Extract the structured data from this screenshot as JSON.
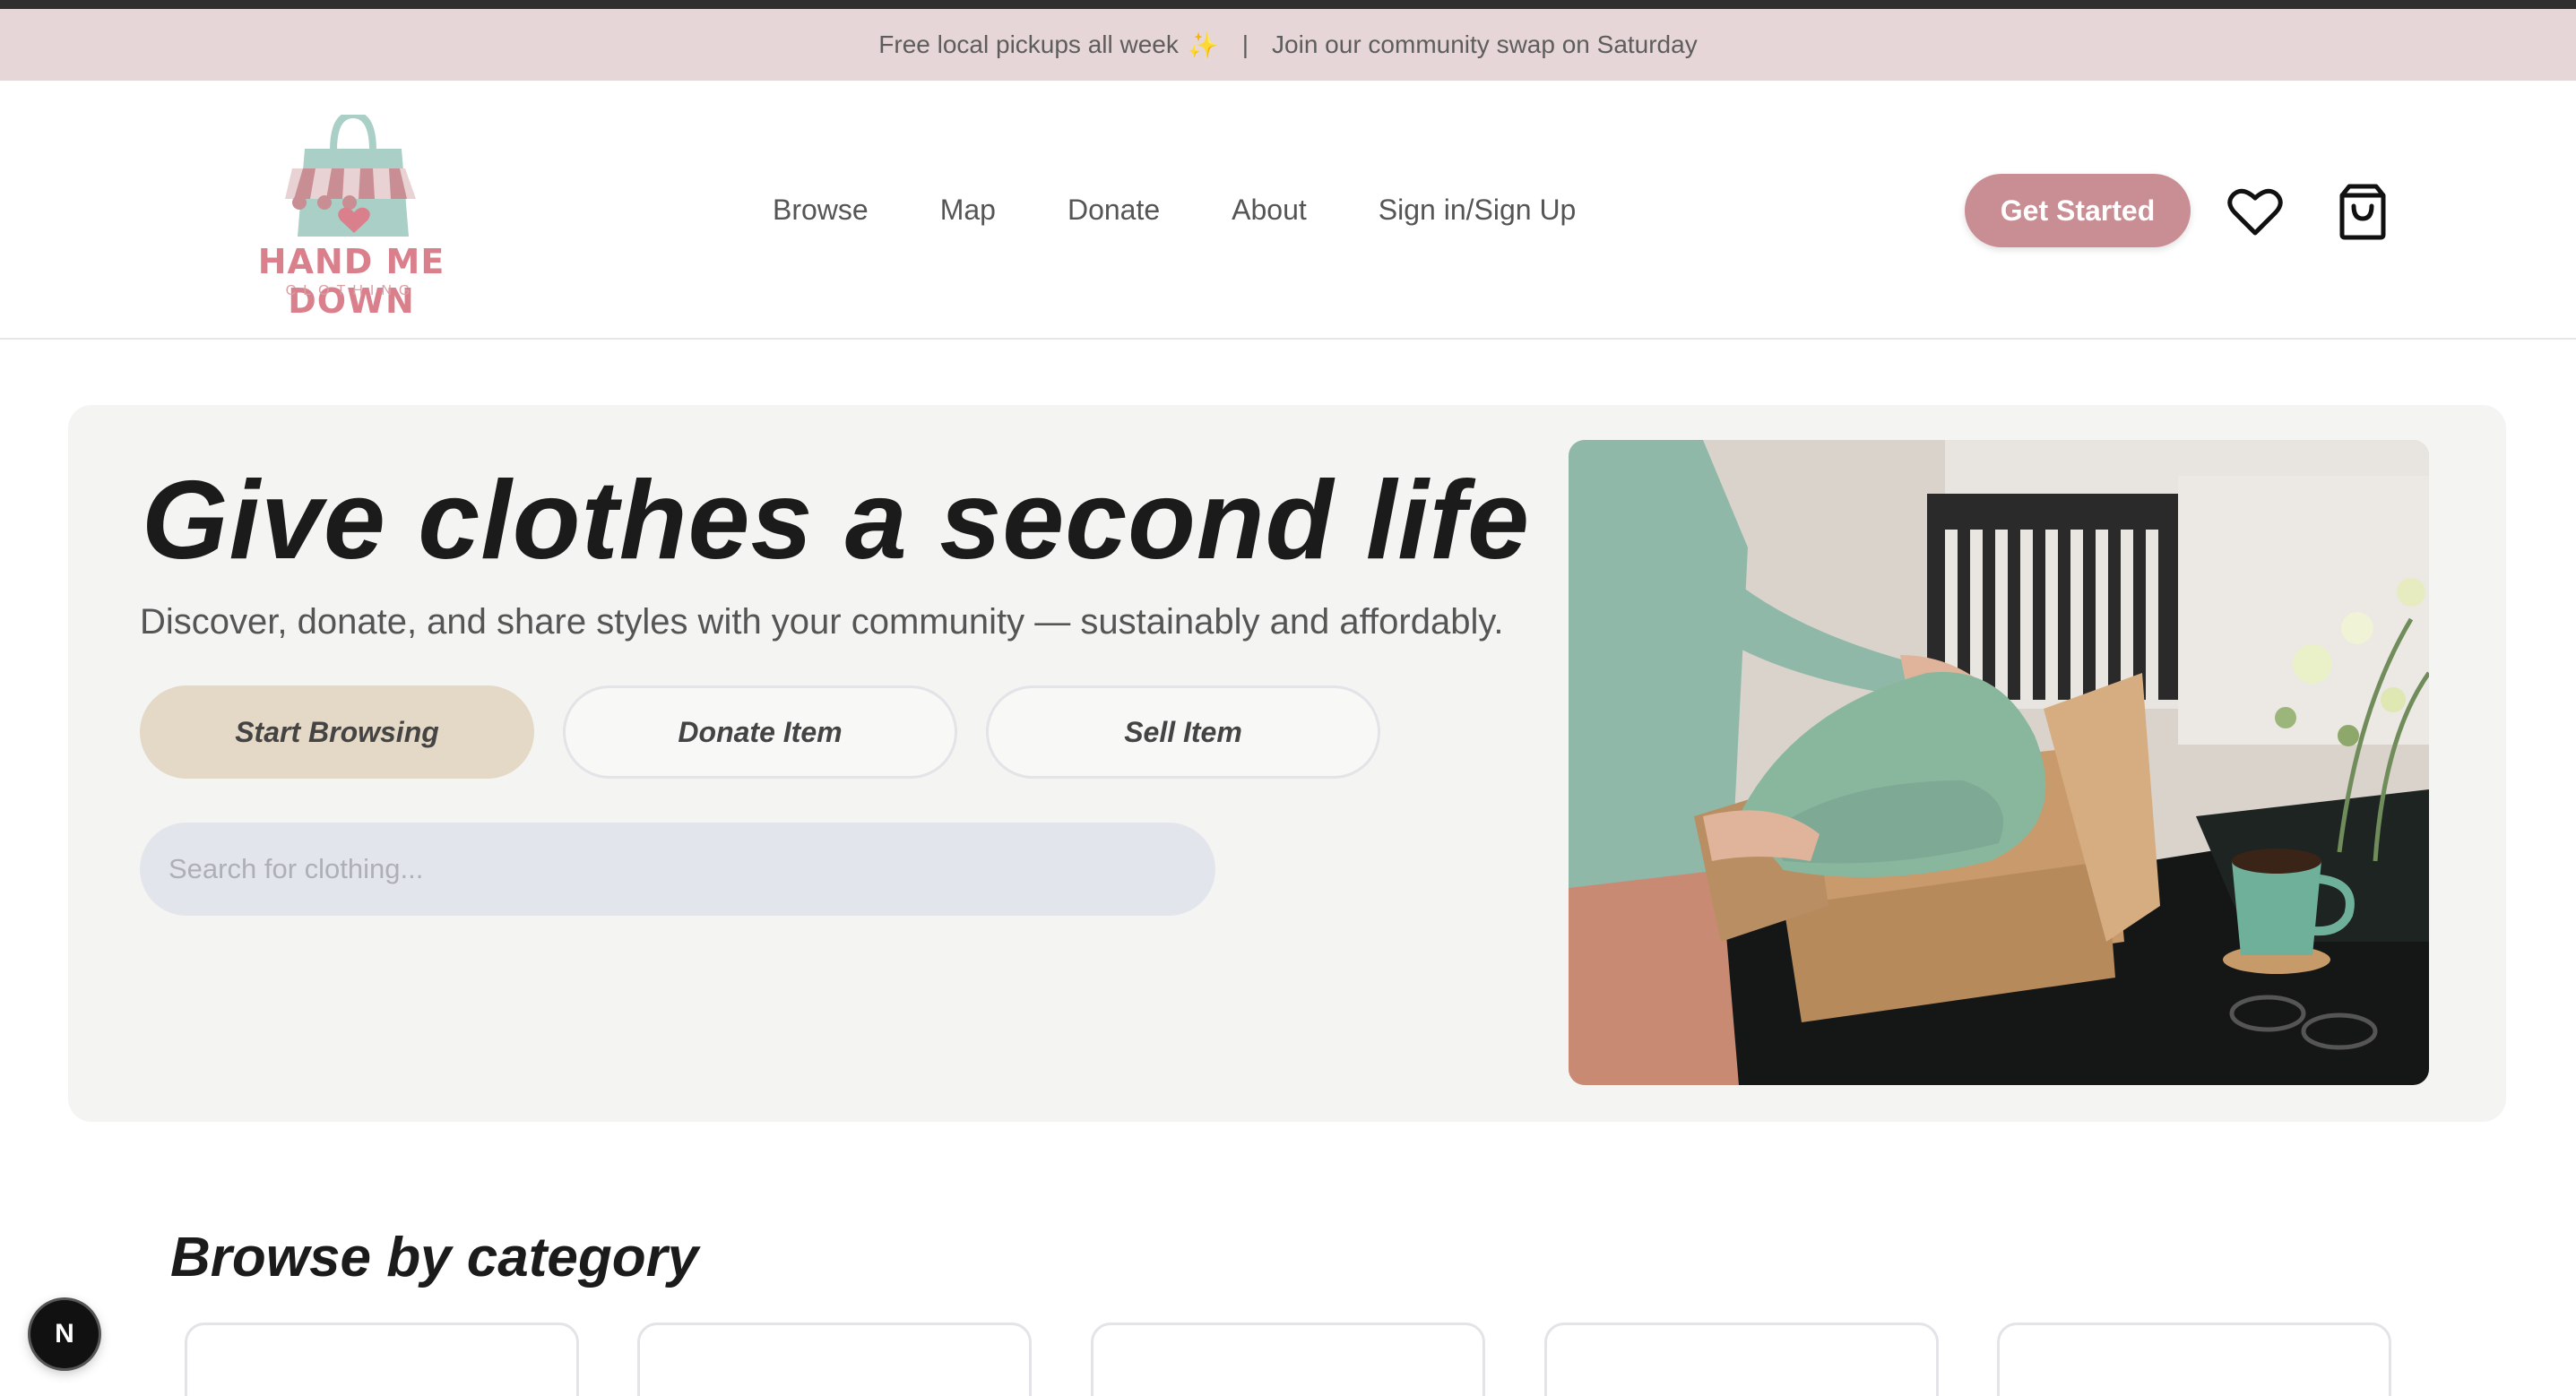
{
  "announcement": {
    "left_text": "Free local pickups all week",
    "sparkle": "✨",
    "separator": "|",
    "right_text": "Join our community swap on Saturday"
  },
  "logo": {
    "name": "HAND ME DOWN",
    "subtitle": "CLOTHING"
  },
  "nav": {
    "items": [
      "Browse",
      "Map",
      "Donate",
      "About",
      "Sign in/Sign Up"
    ]
  },
  "header_actions": {
    "get_started": "Get Started",
    "wishlist_icon": "heart-icon",
    "cart_icon": "shopping-bag-icon"
  },
  "hero": {
    "title": "Give clothes a second life",
    "subtitle": "Discover, donate, and share styles with your community — sustainably and affordably.",
    "buttons": {
      "start_browsing": "Start Browsing",
      "donate_item": "Donate Item",
      "sell_item": "Sell Item"
    },
    "search_placeholder": "Search for clothing..."
  },
  "categories": {
    "title": "Browse by category"
  },
  "dev_badge": "N",
  "colors": {
    "announcement_bg": "#e7d6d7",
    "accent_pink": "#c98e93",
    "primary_button": "#e4d8c6",
    "hero_bg": "#f4f4f2",
    "search_bg": "#e3e5ec"
  }
}
